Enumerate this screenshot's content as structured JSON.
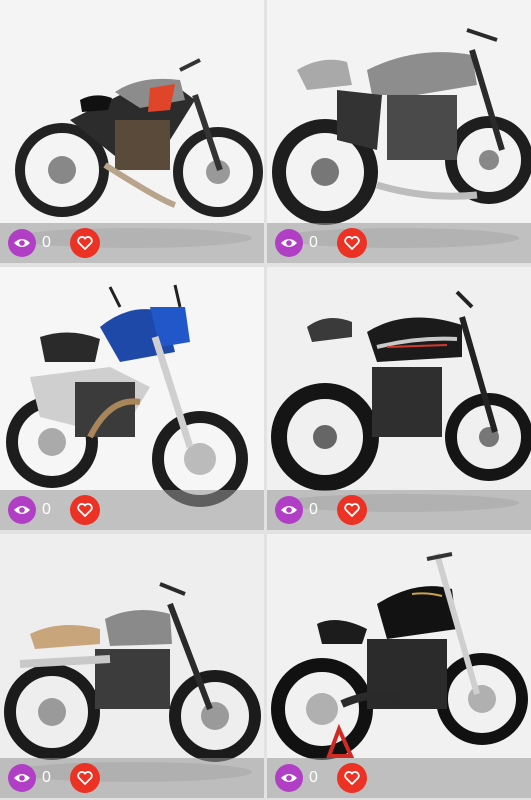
{
  "colors": {
    "eye_button": "#b13fc6",
    "favorite_button": "#ec3224",
    "stats_bar": "#969696"
  },
  "gallery": {
    "items": [
      {
        "views": "0",
        "eye_icon": "eye-icon",
        "fav_icon": "heart-icon"
      },
      {
        "views": "0",
        "eye_icon": "eye-icon",
        "fav_icon": "heart-icon"
      },
      {
        "views": "0",
        "eye_icon": "eye-icon",
        "fav_icon": "heart-icon"
      },
      {
        "views": "0",
        "eye_icon": "eye-icon",
        "fav_icon": "heart-icon"
      },
      {
        "views": "0",
        "eye_icon": "eye-icon",
        "fav_icon": "heart-icon"
      },
      {
        "views": "0",
        "eye_icon": "eye-icon",
        "fav_icon": "heart-icon"
      }
    ]
  }
}
